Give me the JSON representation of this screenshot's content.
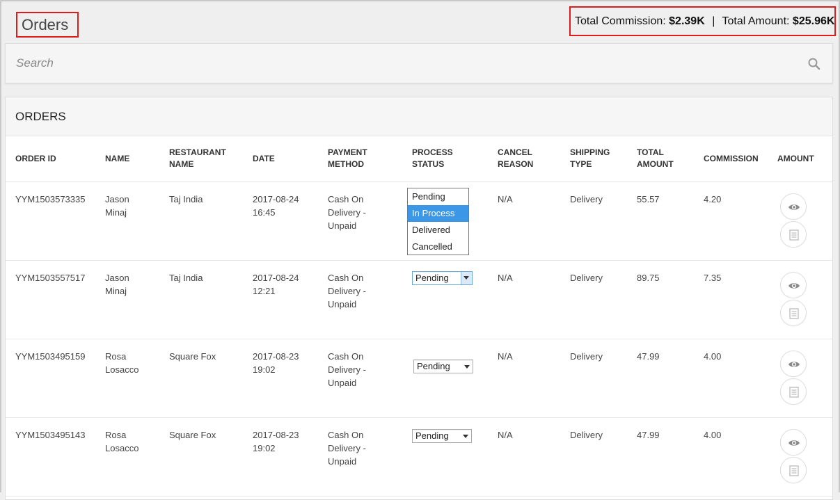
{
  "page": {
    "title": "Orders",
    "totals": {
      "commission_label": "Total Commission:",
      "commission_value": "$2.39K",
      "separator": "|",
      "amount_label": "Total Amount:",
      "amount_value": "$25.96K"
    }
  },
  "search": {
    "placeholder": "Search",
    "icon": "search-icon"
  },
  "orders": {
    "panel_title": "ORDERS",
    "columns": [
      [
        "ORDER ID"
      ],
      [
        "NAME"
      ],
      [
        "RESTAURANT",
        "NAME"
      ],
      [
        "DATE"
      ],
      [
        "PAYMENT",
        "METHOD"
      ],
      [
        "PROCESS",
        "STATUS"
      ],
      [
        "CANCEL",
        "REASON"
      ],
      [
        "SHIPPING",
        "TYPE"
      ],
      [
        "TOTAL",
        "AMOUNT"
      ],
      [
        "COMMISSION"
      ],
      [
        "AMOUNT"
      ]
    ],
    "rows": [
      {
        "order_id": "YYM1503573335",
        "name": [
          "Jason",
          "Minaj"
        ],
        "restaurant": "Taj India",
        "date": [
          "2017-08-24",
          "16:45"
        ],
        "payment": [
          "Cash On",
          "Delivery -",
          "Unpaid"
        ],
        "status": "Delivered",
        "cancel_reason": "N/A",
        "shipping": "Delivery",
        "total": "55.57",
        "commission": "4.20"
      },
      {
        "order_id": "YYM1503557517",
        "name": [
          "Jason",
          "Minaj"
        ],
        "restaurant": "Taj India",
        "date": [
          "2017-08-24",
          "12:21"
        ],
        "payment": [
          "Cash On",
          "Delivery -",
          "Unpaid"
        ],
        "status": "Pending",
        "cancel_reason": "N/A",
        "shipping": "Delivery",
        "total": "89.75",
        "commission": "7.35"
      },
      {
        "order_id": "YYM1503495159",
        "name": [
          "Rosa",
          "Losacco"
        ],
        "restaurant": "Square Fox",
        "date": [
          "2017-08-23",
          "19:02"
        ],
        "payment": [
          "Cash On",
          "Delivery -",
          "Unpaid"
        ],
        "status": "Pending",
        "cancel_reason": "N/A",
        "shipping": "Delivery",
        "total": "47.99",
        "commission": "4.00"
      },
      {
        "order_id": "YYM1503495143",
        "name": [
          "Rosa",
          "Losacco"
        ],
        "restaurant": "Square Fox",
        "date": [
          "2017-08-23",
          "19:02"
        ],
        "payment": [
          "Cash On",
          "Delivery -",
          "Unpaid"
        ],
        "status": "Pending",
        "cancel_reason": "N/A",
        "shipping": "Delivery",
        "total": "47.99",
        "commission": "4.00"
      }
    ],
    "status_dropdown": {
      "options": [
        "Pending",
        "In Process",
        "Delivered",
        "Cancelled"
      ],
      "highlighted": "In Process",
      "highlight_color": "#3c97e6"
    },
    "row_actions": [
      "eye-icon",
      "document-icon"
    ]
  },
  "colors": {
    "highlight_border": "#e01b1b"
  }
}
